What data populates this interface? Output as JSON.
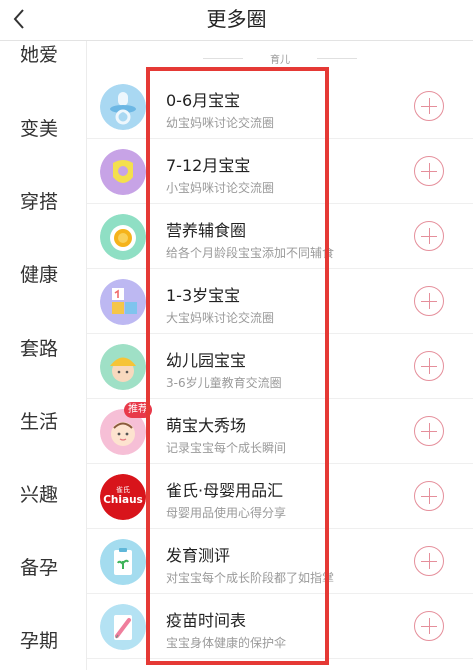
{
  "header": {
    "title": "更多圈"
  },
  "sidebar": {
    "items": [
      {
        "label": "她爱"
      },
      {
        "label": "变美"
      },
      {
        "label": "穿搭"
      },
      {
        "label": "健康"
      },
      {
        "label": "套路"
      },
      {
        "label": "生活"
      },
      {
        "label": "兴趣"
      },
      {
        "label": "备孕"
      },
      {
        "label": "孕期"
      }
    ]
  },
  "main": {
    "section_label": "育儿",
    "badge": "推荐",
    "circles": [
      {
        "title": "0-6月宝宝",
        "subtitle": "幼宝妈咪讨论交流圈",
        "icon": "pacifier-icon"
      },
      {
        "title": "7-12月宝宝",
        "subtitle": "小宝妈咪讨论交流圈",
        "icon": "bib-icon"
      },
      {
        "title": "营养辅食圈",
        "subtitle": "给各个月龄段宝宝添加不同辅食",
        "icon": "food-bowl-icon"
      },
      {
        "title": "1-3岁宝宝",
        "subtitle": "大宝妈咪讨论交流圈",
        "icon": "number-blocks-icon"
      },
      {
        "title": "幼儿园宝宝",
        "subtitle": "3-6岁儿童教育交流圈",
        "icon": "child-hat-icon"
      },
      {
        "title": "萌宝大秀场",
        "subtitle": "记录宝宝每个成长瞬间",
        "icon": "baby-face-icon"
      },
      {
        "title": "雀氏·母婴用品汇",
        "subtitle": "母婴用品使用心得分享",
        "icon": "chiaus-logo-icon",
        "logo_text": "Chiaus",
        "logo_small_text": "雀氏"
      },
      {
        "title": "发育测评",
        "subtitle": "对宝宝每个成长阶段都了如指掌",
        "icon": "clipboard-icon"
      },
      {
        "title": "疫苗时间表",
        "subtitle": "宝宝身体健康的保护伞",
        "icon": "syringe-icon"
      }
    ]
  },
  "colors": {
    "accent": "#e58f9b",
    "highlight_border": "#e53935",
    "badge": "#e8394a"
  }
}
